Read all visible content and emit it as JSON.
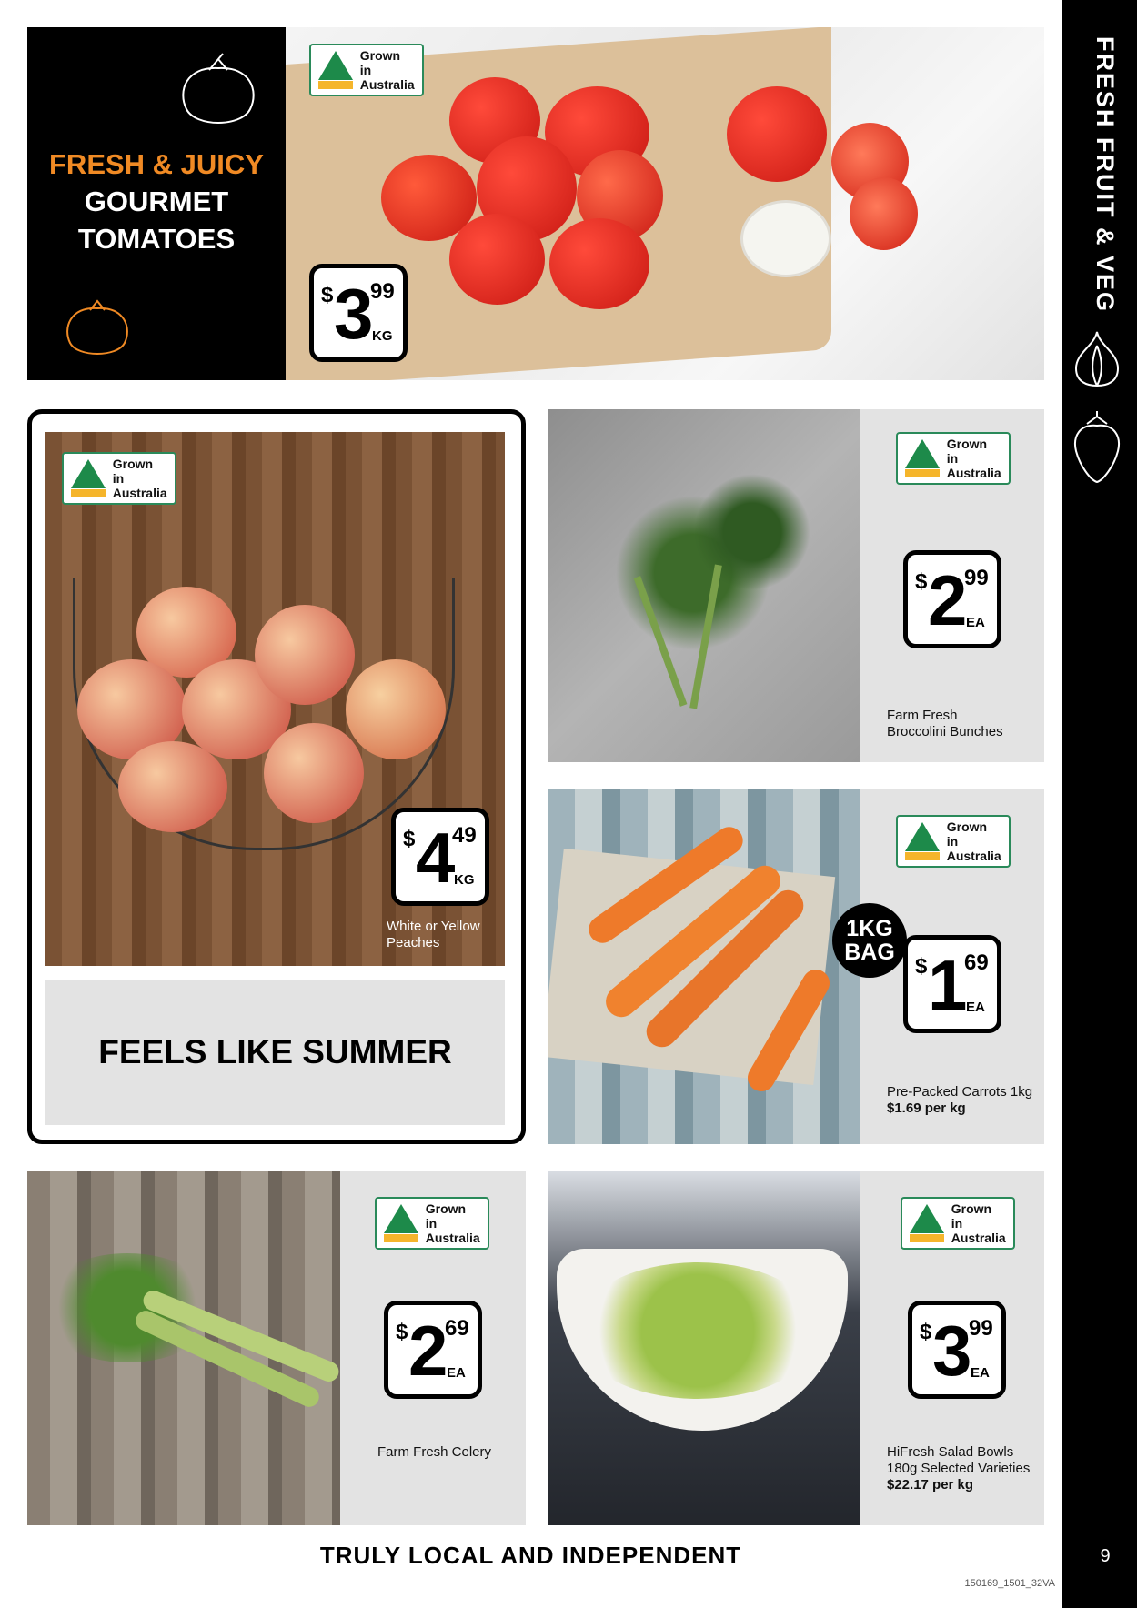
{
  "sidebar": {
    "title": "FRESH FRUIT & VEG",
    "icons": [
      "garlic-icon",
      "strawberry-icon"
    ],
    "page_number": "9"
  },
  "badge": {
    "line1": "Grown in",
    "line2": "Australia"
  },
  "hero": {
    "line1": "FRESH & JUICY",
    "line2": "GOURMET",
    "line3": "TOMATOES",
    "price": {
      "dollar": "$",
      "whole": "3",
      "cents": "99",
      "unit": "KG"
    }
  },
  "peaches": {
    "desc1": "White or Yellow",
    "desc2": "Peaches",
    "price": {
      "dollar": "$",
      "whole": "4",
      "cents": "49",
      "unit": "KG"
    },
    "banner": "FEELS LIKE SUMMER"
  },
  "broccolini": {
    "desc1": "Farm Fresh",
    "desc2": "Broccolini Bunches",
    "price": {
      "dollar": "$",
      "whole": "2",
      "cents": "99",
      "unit": "EA"
    }
  },
  "carrots": {
    "desc1": "Pre-Packed Carrots 1kg",
    "desc2": "$1.69 per kg",
    "bag_line1": "1KG",
    "bag_line2": "BAG",
    "price": {
      "dollar": "$",
      "whole": "1",
      "cents": "69",
      "unit": "EA"
    }
  },
  "celery": {
    "desc1": "Farm Fresh Celery",
    "price": {
      "dollar": "$",
      "whole": "2",
      "cents": "69",
      "unit": "EA"
    }
  },
  "salad": {
    "desc1": "HiFresh Salad Bowls",
    "desc2": "180g Selected Varieties",
    "desc3": "$22.17 per kg",
    "price": {
      "dollar": "$",
      "whole": "3",
      "cents": "99",
      "unit": "EA"
    }
  },
  "footer": {
    "tagline": "TRULY LOCAL AND INDEPENDENT",
    "code": "150169_1501_32VA"
  },
  "colors": {
    "accent": "#f08a24",
    "panel": "#e3e3e3",
    "badge_green": "#2a8a5a",
    "black": "#000000"
  }
}
